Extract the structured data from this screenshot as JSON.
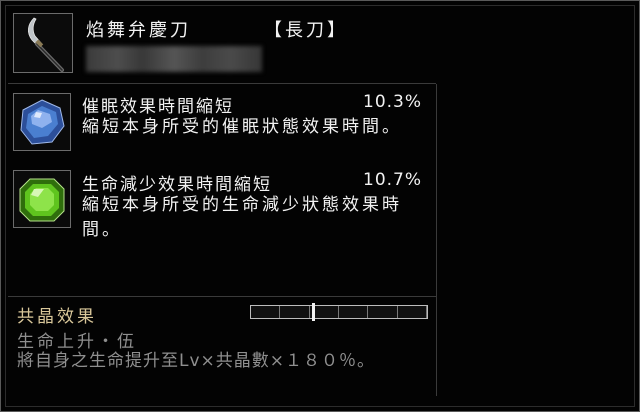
{
  "item": {
    "name": "焰舞弁慶刀",
    "type": "【長刀】",
    "icon": "naginata-icon"
  },
  "effects": [
    {
      "gem": "blue-gem-icon",
      "gem_color": "#4a7fd0",
      "title": "催眠效果時間縮短",
      "value": "10.3%",
      "description": "縮短本身所受的催眠狀態效果時間。"
    },
    {
      "gem": "green-gem-icon",
      "gem_color": "#5fc41e",
      "title": "生命減少效果時間縮短",
      "value": "10.7%",
      "description": "縮短本身所受的生命減少狀態效果時\n間。"
    }
  ],
  "resonance": {
    "title": "共晶效果",
    "subtitle": "生命上升・伍",
    "description": "將自身之生命提升至Lv×共晶數×１８０％。",
    "progress_segments": 6,
    "progress_fraction": 0.35
  },
  "colors": {
    "resonance_title": "#d9c79a",
    "dim_text": "#8f8f8f"
  }
}
